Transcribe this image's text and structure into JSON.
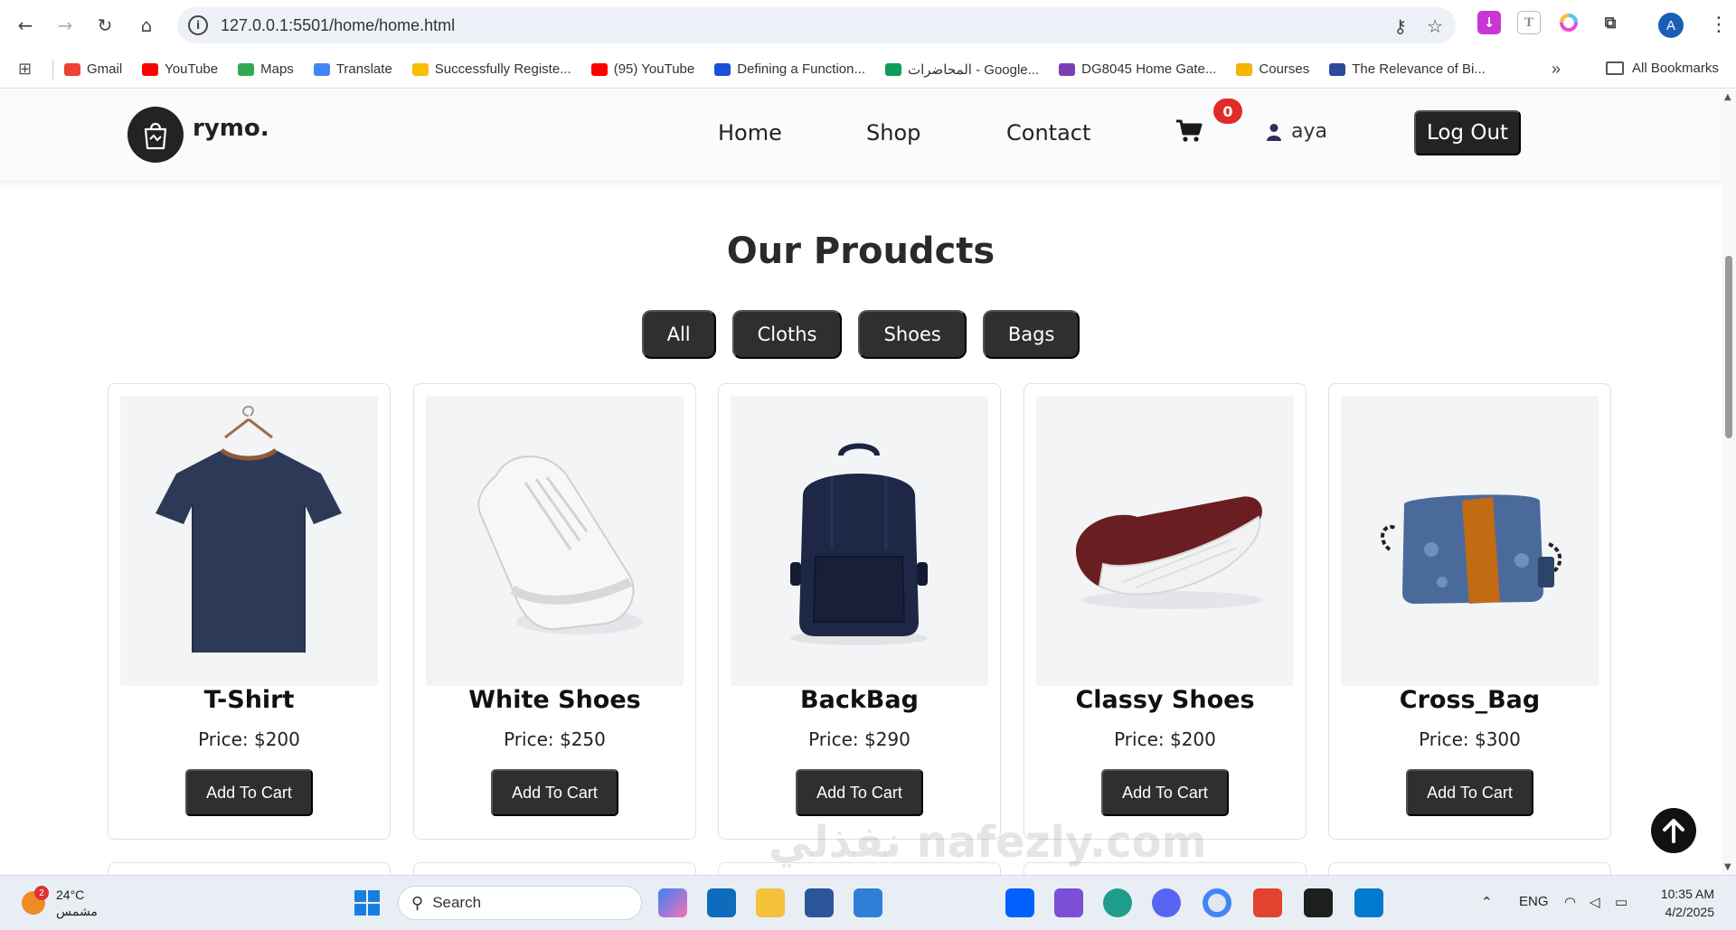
{
  "browser": {
    "url": "127.0.0.1:5501/home/home.html",
    "profile_initial": "A",
    "bookmarks": [
      {
        "label": "Gmail",
        "color": "#ea4335"
      },
      {
        "label": "YouTube",
        "color": "#ff0000"
      },
      {
        "label": "Maps",
        "color": "#34a853"
      },
      {
        "label": "Translate",
        "color": "#4285f4"
      },
      {
        "label": "Successfully Registe...",
        "color": "#fbbc04"
      },
      {
        "label": "(95) YouTube",
        "color": "#ff0000"
      },
      {
        "label": "Defining a Function...",
        "color": "#1a4fd6"
      },
      {
        "label": "المحاضرات - Google...",
        "color": "#0f9d58"
      },
      {
        "label": "DG8045 Home Gate...",
        "color": "#7b3fb5"
      },
      {
        "label": "Courses",
        "color": "#f4b400"
      },
      {
        "label": "The Relevance of Bi...",
        "color": "#2c4a9a"
      }
    ],
    "all_bookmarks_label": "All Bookmarks"
  },
  "site": {
    "brand": "rymo.",
    "nav": [
      {
        "label": "Home"
      },
      {
        "label": "Shop"
      },
      {
        "label": "Contact"
      }
    ],
    "cart_count": "0",
    "username": "aya",
    "logout_label": "Log Out",
    "section_title": "Our Proudcts",
    "filters": [
      {
        "label": "All"
      },
      {
        "label": "Cloths"
      },
      {
        "label": "Shoes"
      },
      {
        "label": "Bags"
      }
    ],
    "products": [
      {
        "name": "T-Shirt",
        "price": "Price: $200",
        "button": "Add To Cart",
        "image": "tshirt-image"
      },
      {
        "name": "White Shoes",
        "price": "Price: $250",
        "button": "Add To Cart",
        "image": "white-shoe-image"
      },
      {
        "name": "BackBag",
        "price": "Price: $290",
        "button": "Add To Cart",
        "image": "backpack-image"
      },
      {
        "name": "Classy Shoes",
        "price": "Price: $200",
        "button": "Add To Cart",
        "image": "classy-shoe-image"
      },
      {
        "name": "Cross_Bag",
        "price": "Price: $300",
        "button": "Add To Cart",
        "image": "cross-bag-image"
      }
    ],
    "watermark": "نفذلي nafezly.com",
    "accent_dark": "#2f2f2f",
    "badge_color": "#e02b2b"
  },
  "taskbar": {
    "weather_temp": "24°C",
    "weather_desc": "مشمس",
    "weather_badge": "2",
    "search_label": "Search",
    "language": "ENG",
    "time": "10:35 AM",
    "date": "4/2/2025"
  }
}
